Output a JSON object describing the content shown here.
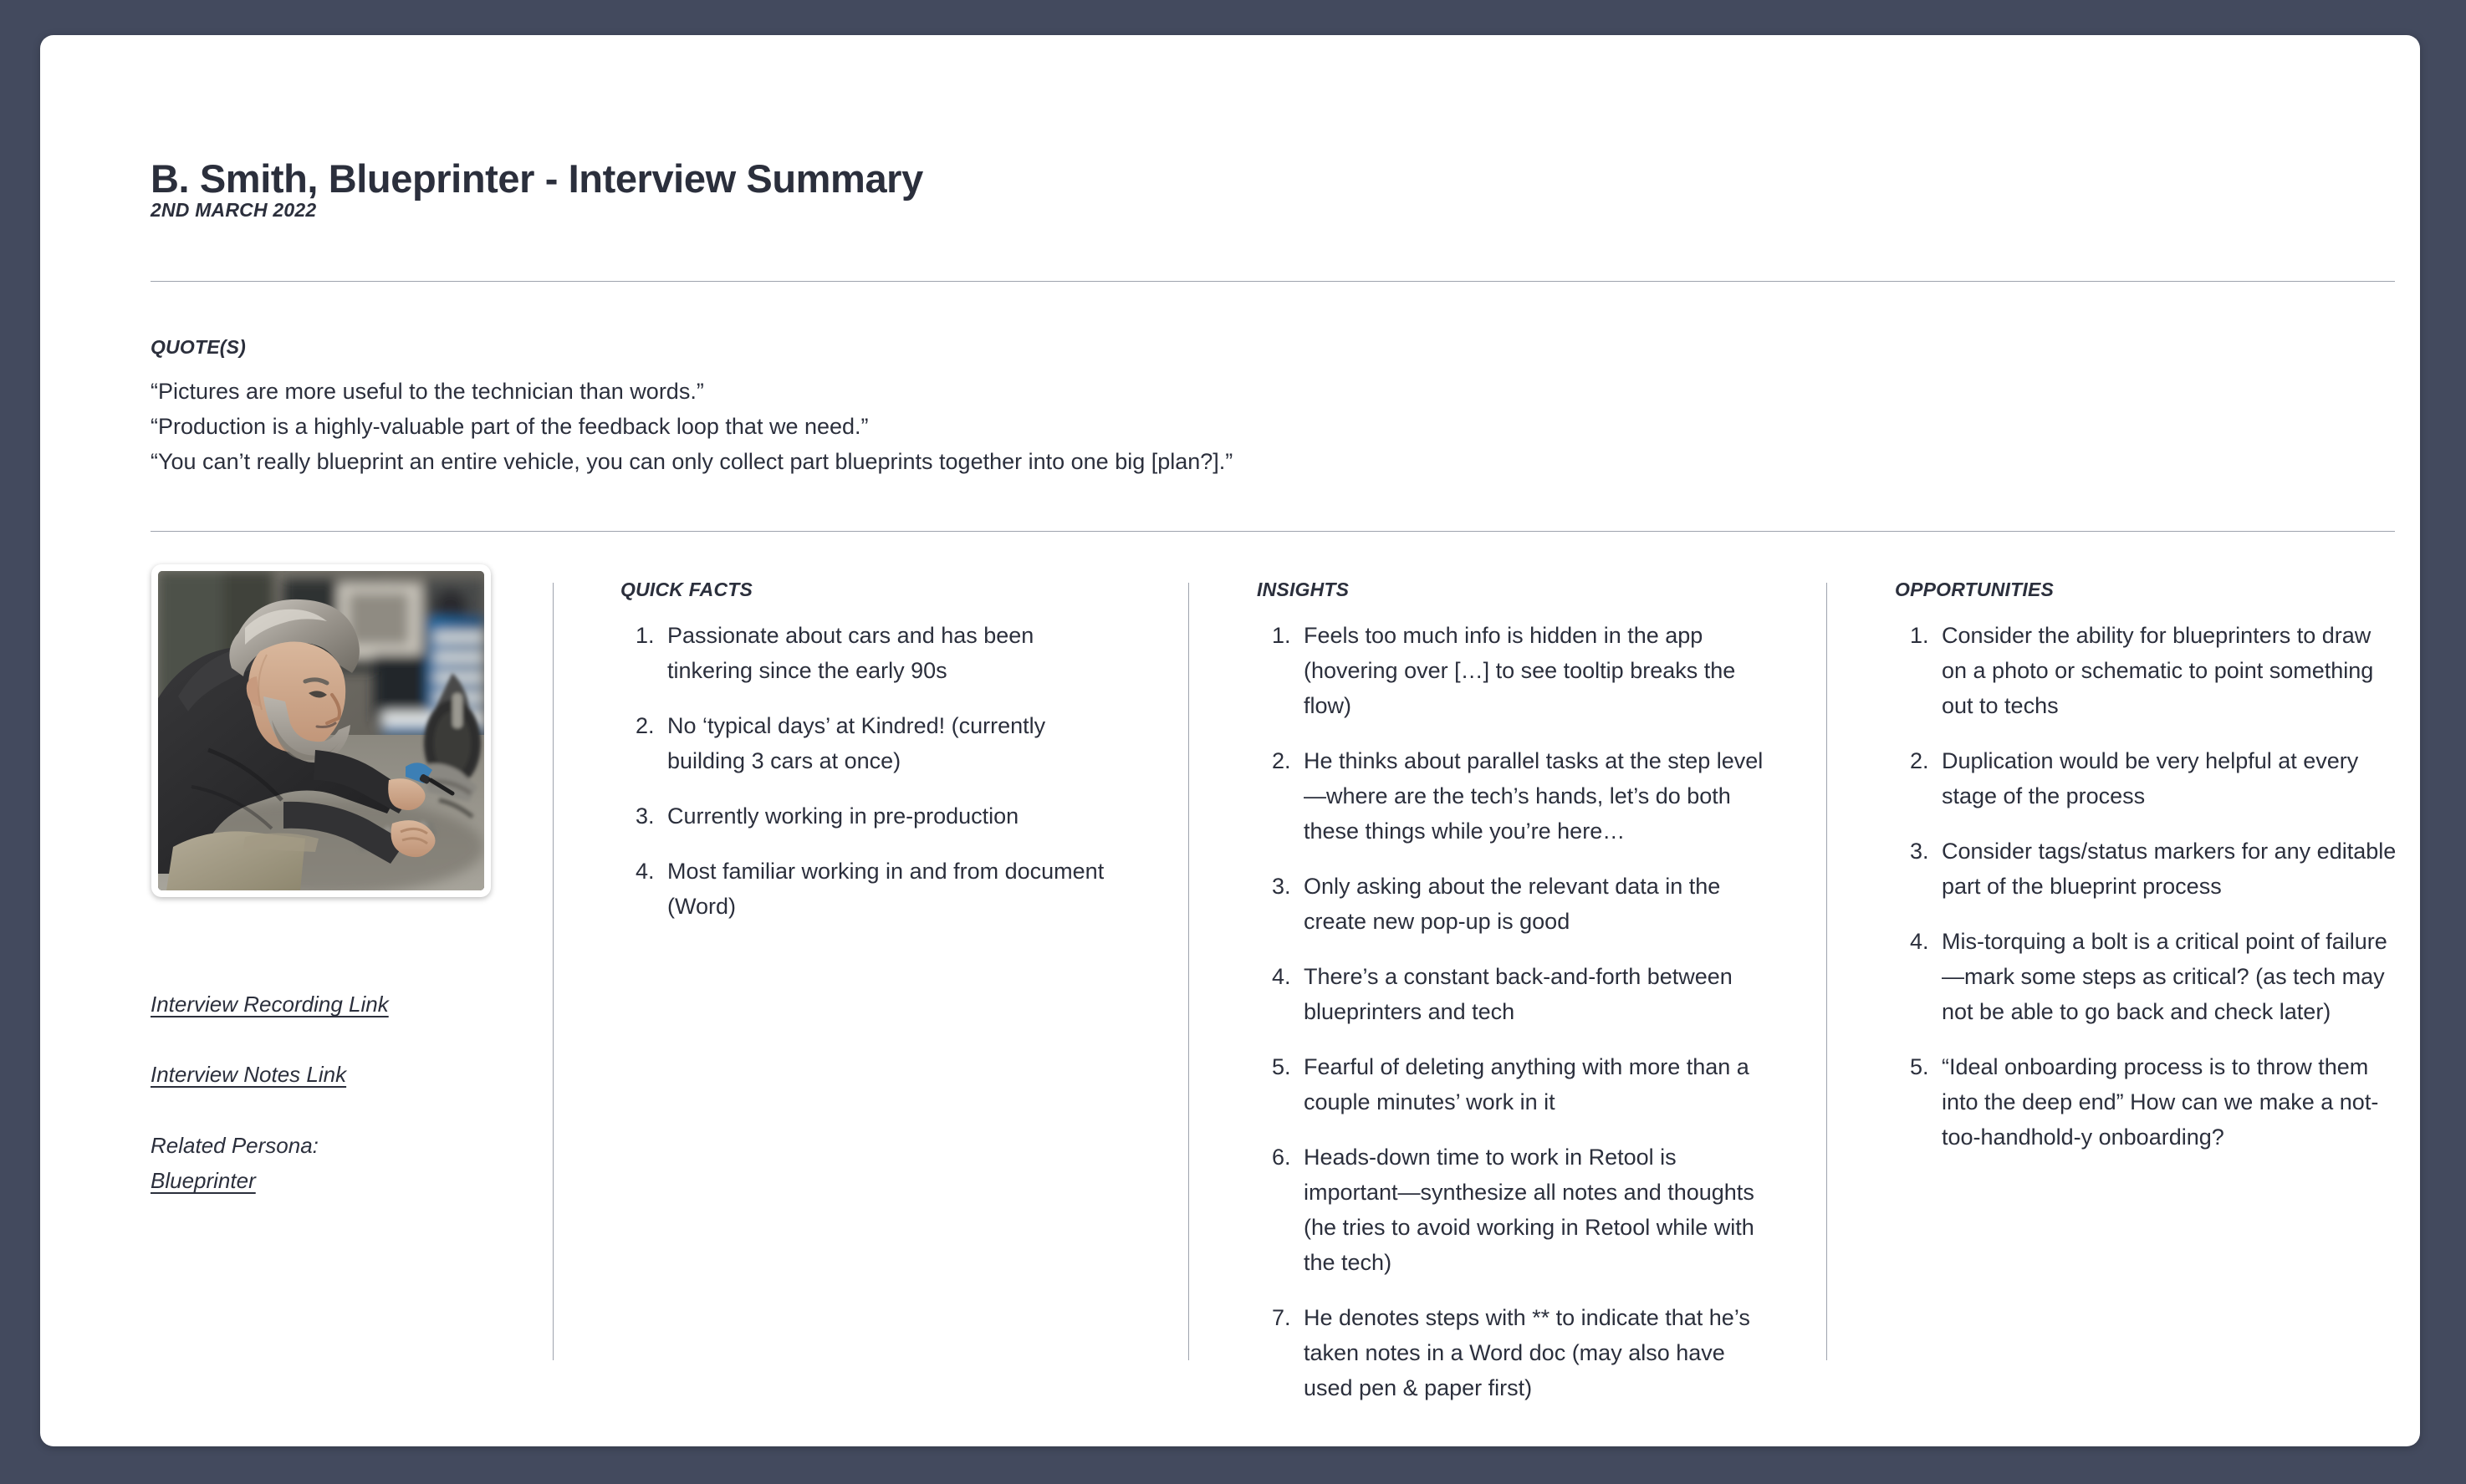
{
  "document": {
    "title": "B. Smith, Blueprinter - Interview Summary",
    "date": "2ND MARCH 2022"
  },
  "quotes": {
    "heading": "QUOTE(S)",
    "items": [
      "“Pictures are more useful to the technician than words.”",
      "“Production is a highly-valuable part of the feedback loop that we need.”",
      "“You can’t really blueprint an entire vehicle, you can only collect part blueprints together into one big [plan?].”"
    ]
  },
  "sidebar": {
    "photo_alt": "Bearded mechanic with grey hair working on a motorcycle in a workshop",
    "recording_link": "Interview Recording Link",
    "notes_link": "Interview Notes Link",
    "persona_label": "Related Persona:",
    "persona_value": "Blueprinter"
  },
  "columns": {
    "quick_facts": {
      "heading": "QUICK FACTS",
      "items": [
        "Passionate about cars and has been tinkering since the early 90s",
        "No ‘typical days’ at Kindred! (currently building 3 cars at once)",
        "Currently working in pre-production",
        "Most familiar working in and from document (Word)"
      ]
    },
    "insights": {
      "heading": "INSIGHTS",
      "items": [
        "Feels too much info is hidden in the app (hovering over […] to see tooltip breaks the flow)",
        "He thinks about parallel tasks at the step level—where are the tech’s hands, let’s do both these things while you’re here…",
        "Only asking about the relevant data in the create new pop-up is good",
        "There’s a constant back-and-forth between blueprinters and tech",
        "Fearful of deleting anything with more than a couple minutes’ work in it",
        "Heads-down time to work in Retool is important—synthesize all notes and thoughts (he tries to avoid working in Retool while with the tech)",
        "He denotes steps with ** to indicate that he’s taken notes in a Word doc (may also have used pen & paper first)"
      ]
    },
    "opportunities": {
      "heading": "OPPORTUNITIES",
      "items": [
        "Consider the ability for blueprinters to draw on a photo or schematic to point something out to techs",
        "Duplication would be very helpful at every stage of the process",
        "Consider tags/status markers for any editable part of the blueprint process",
        "Mis-torquing a bolt is a critical point of failure—mark some steps as critical? (as tech may not be able to go back and check later)",
        "“Ideal onboarding process is to throw them into the deep end” How can we make a not-too-handhold-y onboarding?"
      ]
    }
  },
  "colors": {
    "page_background": "#434a5e",
    "card_background": "#ffffff",
    "text": "#2b2f3c",
    "rule": "#9ea3ae"
  }
}
